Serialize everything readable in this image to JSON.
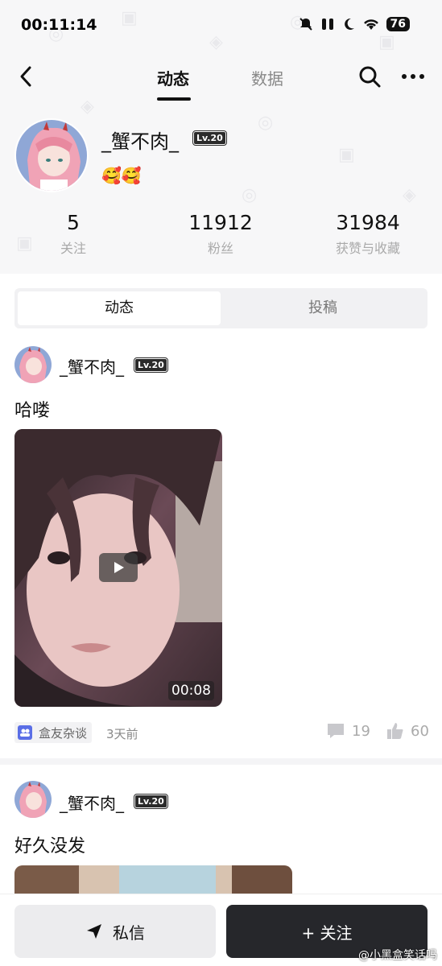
{
  "status": {
    "time": "00:11:14",
    "battery": "76"
  },
  "nav": {
    "tab_active": "动态",
    "tab_inactive": "数据"
  },
  "profile": {
    "name": "_蟹不肉_",
    "level": "Lv.20",
    "emoji": "🥰🥰",
    "stats": [
      {
        "value": "5",
        "label": "关注"
      },
      {
        "value": "11912",
        "label": "粉丝"
      },
      {
        "value": "31984",
        "label": "获赞与收藏"
      }
    ]
  },
  "segment": {
    "active": "动态",
    "inactive": "投稿"
  },
  "posts": [
    {
      "author": "_蟹不肉_",
      "level": "Lv.20",
      "text": "哈喽",
      "video_duration": "00:08",
      "tag": "盒友杂谈",
      "time": "3天前",
      "comments": "19",
      "likes": "60"
    },
    {
      "author": "_蟹不肉_",
      "level": "Lv.20",
      "text": "好久没发"
    }
  ],
  "bottom": {
    "dm_label": "私信",
    "follow_label": "+ 关注"
  },
  "watermark": "@小黑盒笑话吗"
}
